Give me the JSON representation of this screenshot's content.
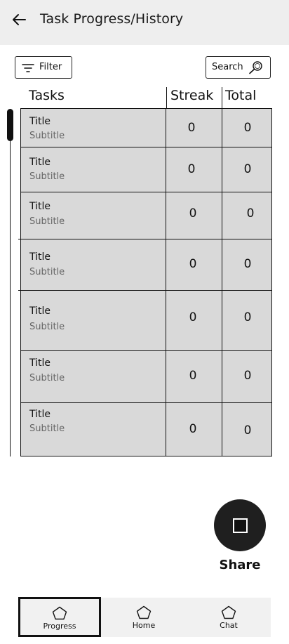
{
  "header": {
    "title": "Task Progress/History",
    "back_icon": "arrow-left-icon"
  },
  "toolbar": {
    "filter_label": "Filter",
    "search_label": "Search"
  },
  "table": {
    "columns": [
      "Tasks",
      "Streak",
      "Total"
    ],
    "rows": [
      {
        "title": "Title",
        "subtitle": "Subtitle",
        "streak": "0",
        "total": "0"
      },
      {
        "title": "Title",
        "subtitle": "Subtitle",
        "streak": "0",
        "total": "0"
      },
      {
        "title": "Title",
        "subtitle": "Subtitle",
        "streak": "0",
        "total": "0"
      },
      {
        "title": "Title",
        "subtitle": "Subtitle",
        "streak": "0",
        "total": "0"
      },
      {
        "title": "Title",
        "subtitle": "Subtitle",
        "streak": "0",
        "total": "0"
      },
      {
        "title": "Title",
        "subtitle": "Subtitle",
        "streak": "0",
        "total": "0"
      },
      {
        "title": "Title",
        "subtitle": "Subtitle",
        "streak": "0",
        "total": "0"
      }
    ]
  },
  "share": {
    "label": "Share"
  },
  "nav": {
    "items": [
      {
        "label": "Progress",
        "icon": "pentagon-icon",
        "active": true
      },
      {
        "label": "Home",
        "icon": "pentagon-icon",
        "active": false
      },
      {
        "label": "Chat",
        "icon": "pentagon-icon",
        "active": false
      }
    ]
  }
}
